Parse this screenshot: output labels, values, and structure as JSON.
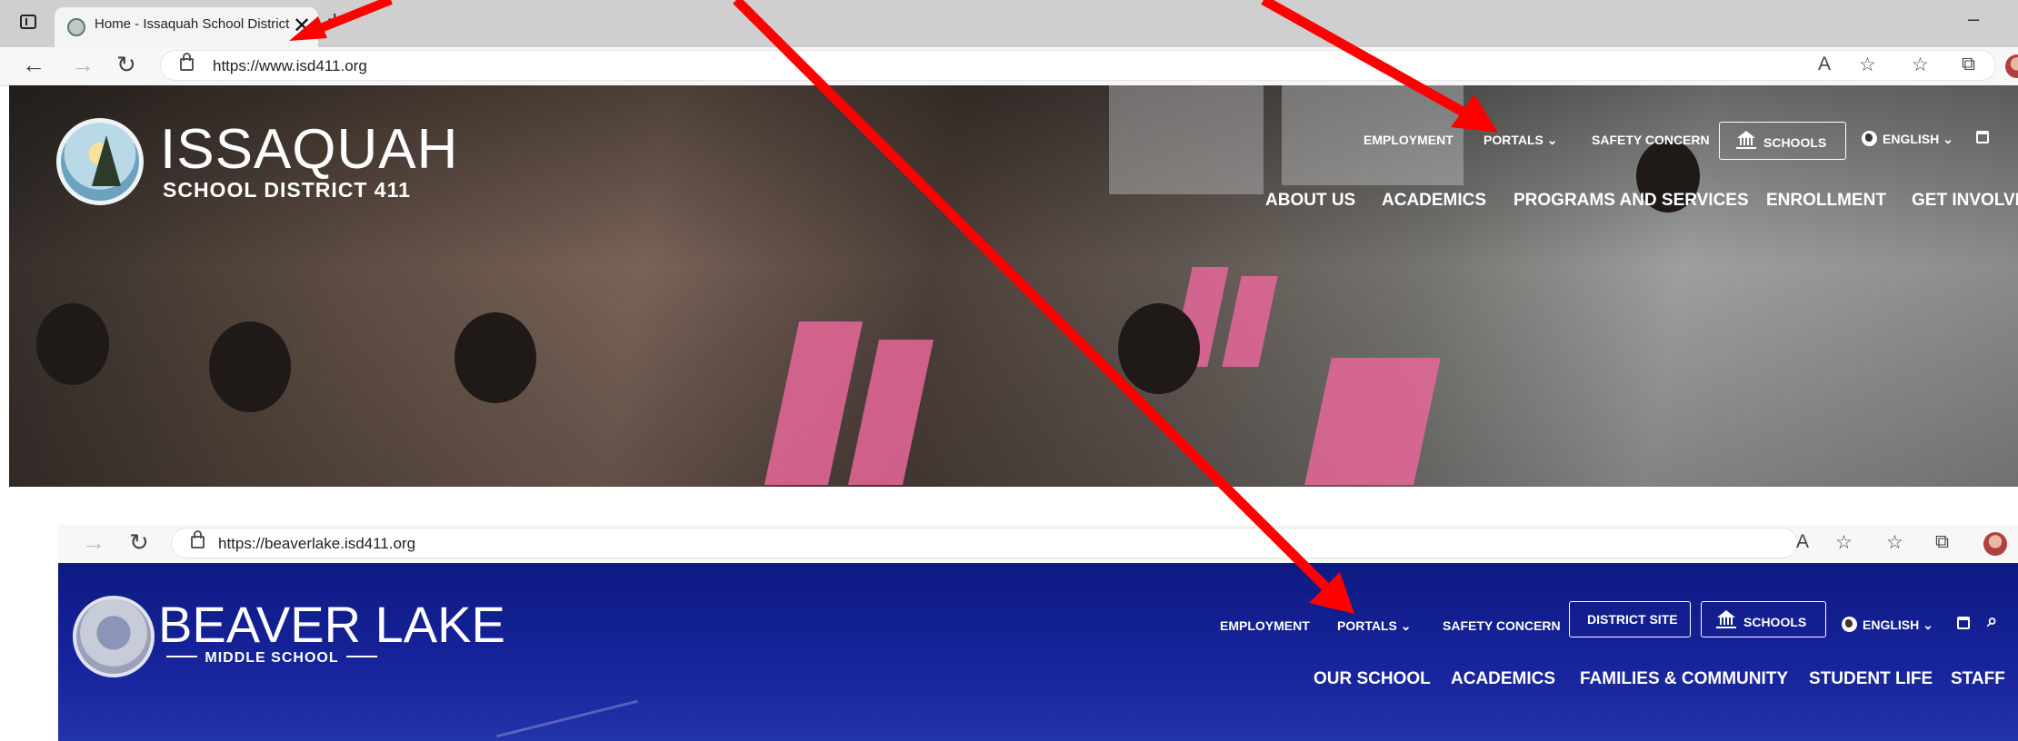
{
  "browser_top": {
    "tab_title": "Home - Issaquah School District",
    "tab_close": "✕",
    "new_tab": "+",
    "minimize": "–",
    "url": "https://www.isd411.org"
  },
  "district_site": {
    "logo_name": "ISSAQUAH",
    "logo_subtitle": "SCHOOL DISTRICT 411",
    "utility_nav": {
      "employment": "EMPLOYMENT",
      "portals": "PORTALS",
      "safety_concern": "SAFETY CONCERN",
      "schools": "SCHOOLS",
      "language": "ENGLISH"
    },
    "main_nav": [
      "ABOUT US",
      "ACADEMICS",
      "PROGRAMS AND SERVICES",
      "ENROLLMENT",
      "GET INVOLVED"
    ]
  },
  "browser_bottom": {
    "url": "https://beaverlake.isd411.org"
  },
  "school_site": {
    "logo_name": "BEAVER LAKE",
    "logo_subtitle": "MIDDLE SCHOOL",
    "utility_nav": {
      "employment": "EMPLOYMENT",
      "portals": "PORTALS",
      "safety_concern": "SAFETY CONCERN",
      "district_site": "DISTRICT SITE",
      "schools": "SCHOOLS",
      "language": "ENGLISH"
    },
    "main_nav": [
      "OUR SCHOOL",
      "ACADEMICS",
      "FAMILIES & COMMUNITY",
      "STUDENT LIFE",
      "STAFF"
    ]
  },
  "annotation": {
    "arrow_color": "#ff0000"
  },
  "colors": {
    "school_banner": "#14209a",
    "browser_chrome": "#cfcfcf"
  }
}
